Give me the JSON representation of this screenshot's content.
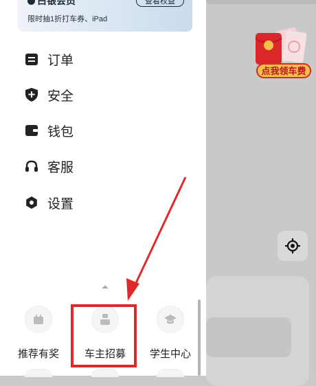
{
  "vip": {
    "title": "白银会员",
    "button": "查看权益",
    "subtitle": "限时抽1折打车券、iPad"
  },
  "menu": [
    {
      "label": "订单",
      "icon": "order-icon"
    },
    {
      "label": "安全",
      "icon": "shield-icon"
    },
    {
      "label": "钱包",
      "icon": "wallet-icon"
    },
    {
      "label": "客服",
      "icon": "headset-icon"
    },
    {
      "label": "设置",
      "icon": "gear-icon"
    }
  ],
  "grid": [
    {
      "label": "推荐有奖",
      "icon": "gift-icon"
    },
    {
      "label": "车主招募",
      "icon": "driver-icon"
    },
    {
      "label": "学生中心",
      "icon": "graduation-cap-icon"
    }
  ],
  "promo": {
    "label": "点我领车费",
    "icon": "red-packet-icon"
  },
  "colors": {
    "highlight": "#e02a2a",
    "promo_text": "#c1121f",
    "promo_bg": "#f2c14a"
  }
}
